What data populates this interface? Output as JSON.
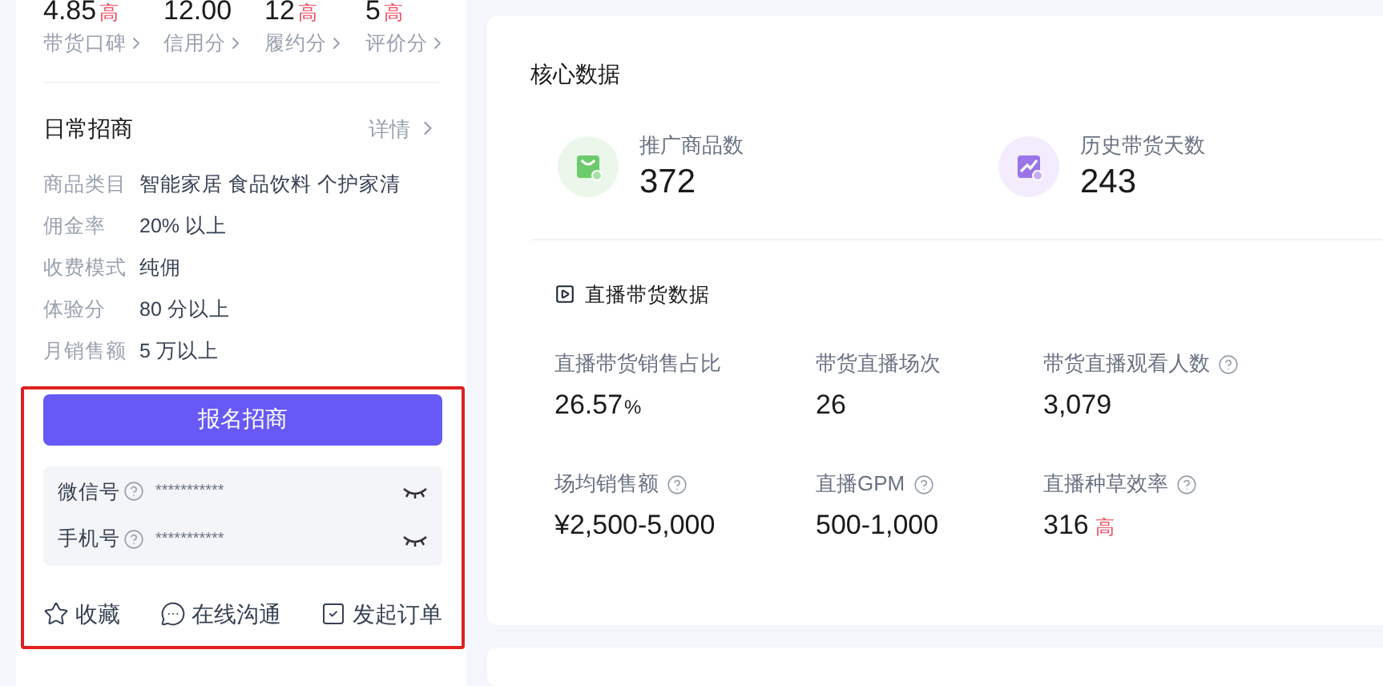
{
  "scores": [
    {
      "value": "4.85",
      "badge": "高",
      "label": "带货口碑"
    },
    {
      "value": "12.00",
      "label": "信用分"
    },
    {
      "value": "12",
      "badge": "高",
      "label": "履约分"
    },
    {
      "value": "5",
      "badge": "高",
      "label": "评价分"
    }
  ],
  "recruit": {
    "title": "日常招商",
    "detail_link": "详情",
    "rows": [
      {
        "label": "商品类目",
        "value": "智能家居 食品饮料 个护家清"
      },
      {
        "label": "佣金率",
        "value": "20% 以上"
      },
      {
        "label": "收费模式",
        "value": "纯佣"
      },
      {
        "label": "体验分",
        "value": "80 分以上"
      },
      {
        "label": "月销售额",
        "value": "5 万以上"
      }
    ],
    "apply_button": "报名招商",
    "contacts": [
      {
        "label": "微信号",
        "value": "***********"
      },
      {
        "label": "手机号",
        "value": "***********"
      }
    ],
    "actions": [
      {
        "kind": "star",
        "label": "收藏"
      },
      {
        "kind": "chat",
        "label": "在线沟通"
      },
      {
        "kind": "order",
        "label": "发起订单"
      }
    ]
  },
  "core": {
    "title": "核心数据",
    "stats": [
      {
        "kind": "bag",
        "label": "推广商品数",
        "value": "372"
      },
      {
        "kind": "trend",
        "label": "历史带货天数",
        "value": "243"
      }
    ]
  },
  "live": {
    "title": "直播带货数据",
    "metrics": [
      {
        "label": "直播带货销售占比",
        "value": "26.57",
        "unit": "%",
        "help": false
      },
      {
        "label": "带货直播场次",
        "value": "26",
        "help": false
      },
      {
        "label": "带货直播观看人数",
        "value": "3,079",
        "help": true
      },
      {
        "label": "场均销售额",
        "value": "¥2,500-5,000",
        "help": true
      },
      {
        "label": "直播GPM",
        "value": "500-1,000",
        "help": true
      },
      {
        "label": "直播种草效率",
        "value": "316",
        "badge": "高",
        "help": true
      }
    ]
  }
}
